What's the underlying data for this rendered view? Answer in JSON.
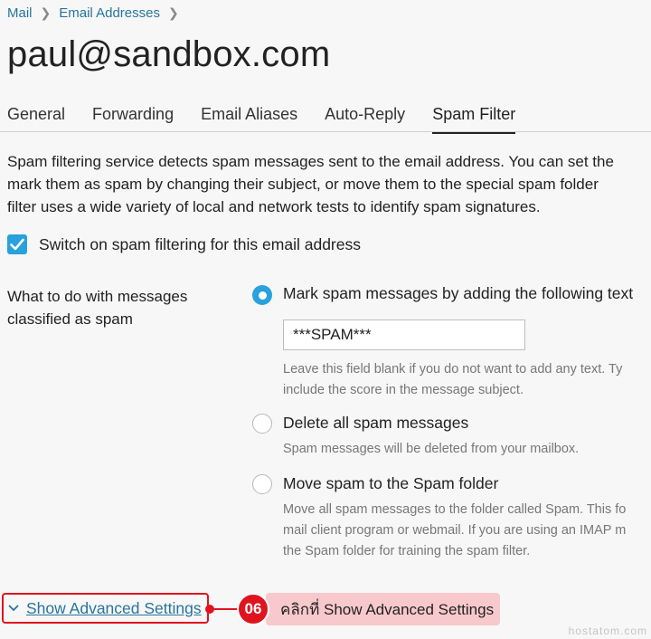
{
  "breadcrumb": {
    "items": [
      "Mail",
      "Email Addresses"
    ]
  },
  "page": {
    "title": "paul@sandbox.com"
  },
  "tabs": [
    {
      "label": "General",
      "active": false
    },
    {
      "label": "Forwarding",
      "active": false
    },
    {
      "label": "Email Aliases",
      "active": false
    },
    {
      "label": "Auto-Reply",
      "active": false
    },
    {
      "label": "Spam Filter",
      "active": true
    }
  ],
  "description": {
    "lines": [
      "Spam filtering service detects spam messages sent to the email address. You can set the",
      "mark them as spam by changing their subject, or move them to the special spam folder",
      "filter uses a wide variety of local and network tests to identify spam signatures."
    ]
  },
  "spam_toggle": {
    "label": "Switch on spam filtering for this email address",
    "checked": true
  },
  "action_field": {
    "label": "What to do with messages classified as spam",
    "options": [
      {
        "label": "Mark spam messages by adding the following text",
        "selected": true,
        "input_value": "***SPAM***",
        "hint_lines": [
          "Leave this field blank if you do not want to add any text. Ty",
          "include the score in the message subject."
        ]
      },
      {
        "label": "Delete all spam messages",
        "selected": false,
        "hint_lines": [
          "Spam messages will be deleted from your mailbox."
        ]
      },
      {
        "label": "Move spam to the Spam folder",
        "selected": false,
        "hint_lines": [
          "Move all spam messages to the folder called Spam. This fo",
          "mail client program or webmail. If you are using an IMAP m",
          "the Spam folder for training the spam filter."
        ]
      }
    ]
  },
  "advanced": {
    "label": "Show Advanced Settings"
  },
  "annotation": {
    "step": "06",
    "text": "คลิกที่ Show Advanced Settings"
  },
  "watermark": "hostatom.com",
  "colors": {
    "accent": "#28a1dc",
    "link": "#28749c",
    "annotation_red": "#e0141e",
    "callout_bg": "#f8c9cc"
  }
}
